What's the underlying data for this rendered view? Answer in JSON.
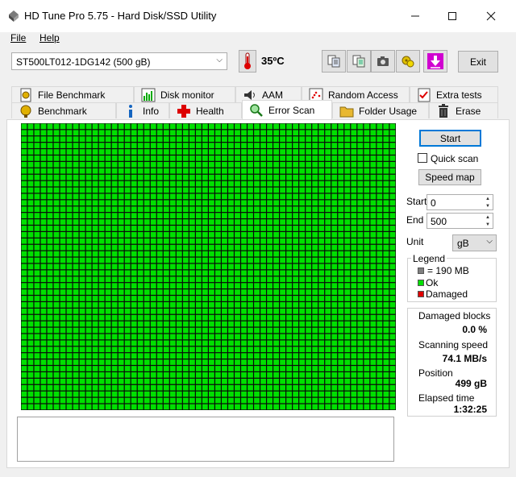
{
  "window": {
    "title": "HD Tune Pro 5.75 - Hard Disk/SSD Utility"
  },
  "menu": [
    {
      "label": "File"
    },
    {
      "label": "Help"
    }
  ],
  "toolbar": {
    "drive": "ST500LT012-1DG142 (500 gB)",
    "temperature": "35",
    "temperature_unit": "ºC",
    "exit_label": "Exit"
  },
  "tabs_row1": [
    {
      "label": "File Benchmark"
    },
    {
      "label": "Disk monitor"
    },
    {
      "label": "AAM"
    },
    {
      "label": "Random Access"
    },
    {
      "label": "Extra tests"
    }
  ],
  "tabs_row2": [
    {
      "label": "Benchmark"
    },
    {
      "label": "Info"
    },
    {
      "label": "Health"
    },
    {
      "label": "Error Scan"
    },
    {
      "label": "Folder Usage"
    },
    {
      "label": "Erase"
    }
  ],
  "active_tab": "Error Scan",
  "controls": {
    "start_label": "Start",
    "quick_scan_label": "Quick scan",
    "quick_scan_checked": false,
    "speed_map_label": "Speed map",
    "start_field_label": "Start",
    "start_value": "0",
    "end_field_label": "End",
    "end_value": "500",
    "unit_label": "Unit",
    "unit_value": "gB"
  },
  "legend": {
    "title": "Legend",
    "block_size": "= 190 MB",
    "ok": "Ok",
    "damaged": "Damaged"
  },
  "stats": {
    "damaged_blocks_label": "Damaged blocks",
    "damaged_blocks_value": "0.0 %",
    "scanning_speed_label": "Scanning speed",
    "scanning_speed_value": "74.1 MB/s",
    "position_label": "Position",
    "position_value": "499 gB",
    "elapsed_label": "Elapsed time",
    "elapsed_value": "1:32:25"
  },
  "scan_grid": {
    "columns": 58,
    "rows": 45,
    "status": "all-ok"
  },
  "colors": {
    "ok": "#00e000",
    "damaged": "#e00000",
    "block": "#808080",
    "accent": "#0078d7"
  }
}
